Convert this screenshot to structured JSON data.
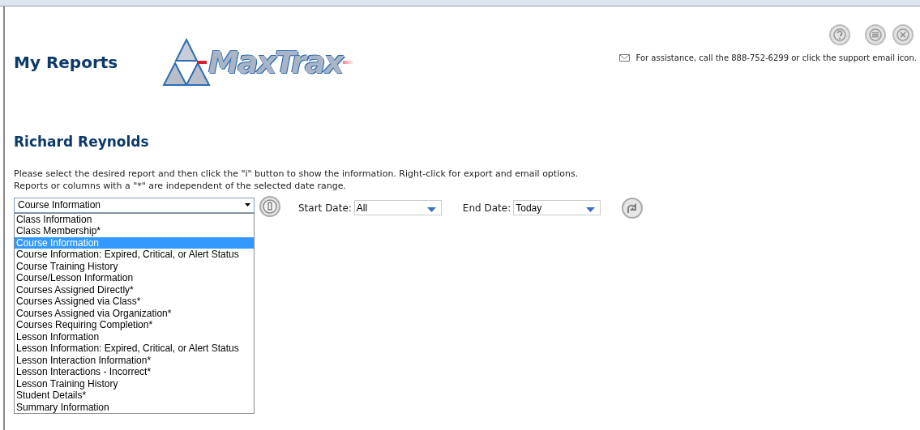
{
  "header": {
    "title": "My Reports",
    "logo_text": "MaxTrax",
    "support_text": "For assistance, call the 888-752-6299 or click the support email icon."
  },
  "user_name": "Richard Reynolds",
  "instructions": [
    "Please select the desired report and then click the \"i\" button to show the information. Right-click for export and email options.",
    "Reports or columns with a \"*\" are independent of the selected date range."
  ],
  "report_select": {
    "value": "Course Information",
    "expanded": true,
    "options": [
      {
        "label": "Class Information",
        "selected": false
      },
      {
        "label": "Class Membership*",
        "selected": false
      },
      {
        "label": "Course Information",
        "selected": true
      },
      {
        "label": "Course Information: Expired, Critical, or Alert Status",
        "selected": false
      },
      {
        "label": "Course Training History",
        "selected": false
      },
      {
        "label": "Course/Lesson Information",
        "selected": false
      },
      {
        "label": "Courses Assigned Directly*",
        "selected": false
      },
      {
        "label": "Courses Assigned via Class*",
        "selected": false
      },
      {
        "label": "Courses Assigned via Organization*",
        "selected": false
      },
      {
        "label": "Courses Requiring Completion*",
        "selected": false
      },
      {
        "label": "Lesson Information",
        "selected": false
      },
      {
        "label": "Lesson Information: Expired, Critical, or Alert Status",
        "selected": false
      },
      {
        "label": "Lesson Interaction Information*",
        "selected": false
      },
      {
        "label": "Lesson Interactions - Incorrect*",
        "selected": false
      },
      {
        "label": "Lesson Training History",
        "selected": false
      },
      {
        "label": "Student Details*",
        "selected": false
      },
      {
        "label": "Summary Information",
        "selected": false
      }
    ]
  },
  "start_date": {
    "label": "Start Date:",
    "value": "All"
  },
  "end_date": {
    "label": "End Date:",
    "value": "Today"
  }
}
